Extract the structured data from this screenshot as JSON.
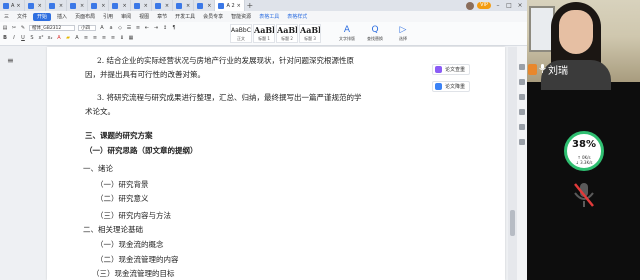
{
  "tabs": [
    {
      "label": "A",
      "active": false
    },
    {
      "label": "",
      "active": false
    },
    {
      "label": "",
      "active": false
    },
    {
      "label": "",
      "active": false
    },
    {
      "label": "",
      "active": false
    },
    {
      "label": "",
      "active": false
    },
    {
      "label": "",
      "active": false
    },
    {
      "label": "",
      "active": false
    },
    {
      "label": "",
      "active": false
    },
    {
      "label": "",
      "active": false
    },
    {
      "label": "A 2",
      "active": true
    }
  ],
  "menu": {
    "items": [
      "三",
      "文件",
      "开始",
      "插入",
      "页面布局",
      "引用",
      "审阅",
      "视图",
      "章节",
      "开发工具",
      "会员专享",
      "智能资源",
      "表格工具",
      "表格样式"
    ],
    "start_index": 2,
    "blue_from": 12
  },
  "ribbon": {
    "font_name": "楷体_GB2312",
    "font_size": "小四",
    "styles": [
      {
        "sample": "AaBbCcDd",
        "name": "正文"
      },
      {
        "sample": "AaBbC",
        "name": "标题 1"
      },
      {
        "sample": "AaBb",
        "name": "标题 2"
      },
      {
        "sample": "AaBbC",
        "name": "标题 3"
      }
    ],
    "tools": [
      {
        "label": "文字排版",
        "icon": "A"
      },
      {
        "label": "查找替换",
        "icon": "Q"
      },
      {
        "label": "选择",
        "icon": "▷"
      }
    ]
  },
  "side_panel": [
    {
      "label": "论文查重",
      "color": "#8b5cf6"
    },
    {
      "label": "论文降重",
      "color": "#3b82f6"
    }
  ],
  "document": {
    "lines": [
      {
        "text": "2. 结合企业的实际经营状况与房地产行业的发展现状，针对问题深究根源性原",
        "bold": false
      },
      {
        "text": "因，并提出具有可行性的改善对策。",
        "bold": false
      },
      {
        "text": "3. 将研究流程与研究成果进行整理，汇总、归纳，最终撰写出一篇严谨规范的学",
        "bold": false
      },
      {
        "text": "术论文。",
        "bold": false
      },
      {
        "text": "三、课题的研究方案",
        "bold": true
      },
      {
        "text": "（一）研究思路（即文章的提纲）",
        "bold": true
      },
      {
        "text": "一、绪论",
        "bold": false
      },
      {
        "text": "（一）研究背景",
        "bold": false
      },
      {
        "text": "（二）研究意义",
        "bold": false
      },
      {
        "text": "（三）研究内容与方法",
        "bold": false
      },
      {
        "text": "二、相关理论基础",
        "bold": false
      },
      {
        "text": "（一）现金流的概念",
        "bold": false
      },
      {
        "text": "（二）现金流管理的内容",
        "bold": false
      },
      {
        "text": "（三）现金流管理的目标",
        "bold": false
      }
    ]
  },
  "video": {
    "participant_name": "刘瑞",
    "network_percent": "38",
    "network_up": "0K/s",
    "network_down": "3.3K/s"
  },
  "colors": {
    "accent": "#2f6fe0",
    "network_ring": "#2fbf71",
    "name_icon": "#e8872c"
  }
}
